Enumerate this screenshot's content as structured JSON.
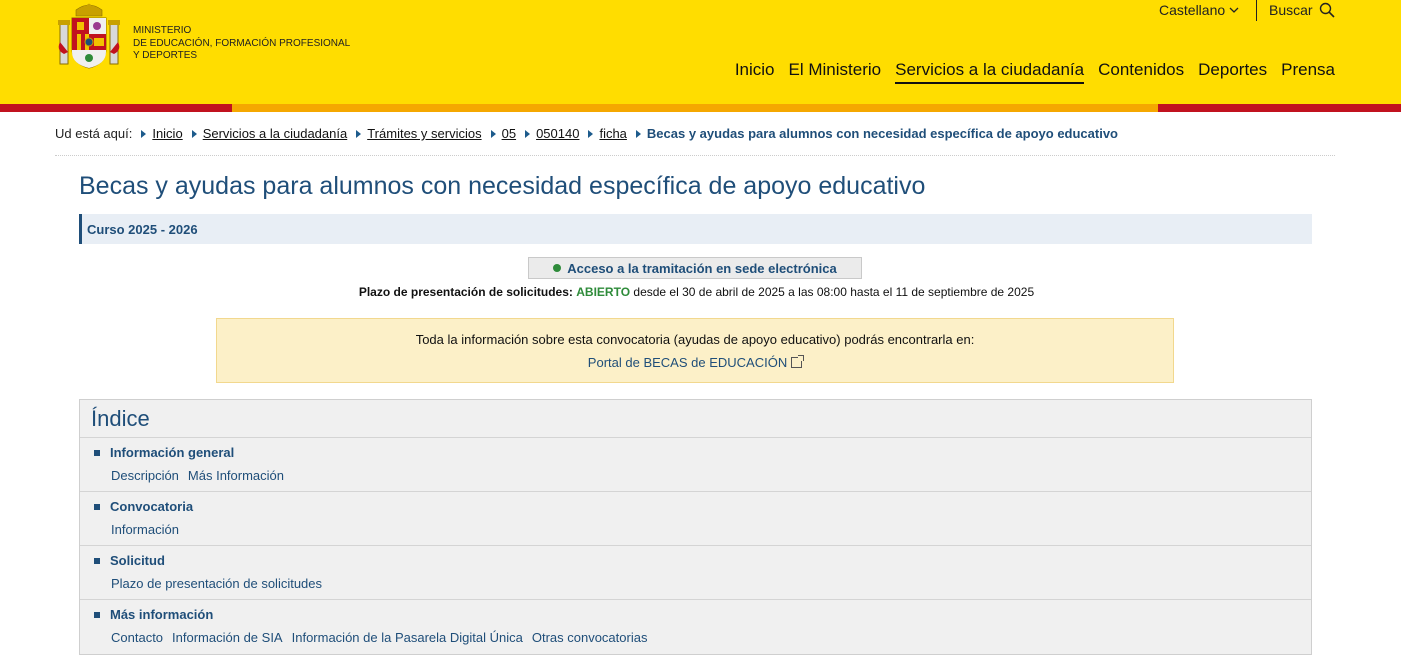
{
  "header": {
    "ministry_lines": [
      "MINISTERIO",
      "DE EDUCACIÓN, FORMACIÓN PROFESIONAL",
      "Y DEPORTES"
    ],
    "language": "Castellano",
    "search_label": "Buscar",
    "nav": [
      {
        "label": "Inicio",
        "active": false
      },
      {
        "label": "El Ministerio",
        "active": false
      },
      {
        "label": "Servicios a la ciudadanía",
        "active": true
      },
      {
        "label": "Contenidos",
        "active": false
      },
      {
        "label": "Deportes",
        "active": false
      },
      {
        "label": "Prensa",
        "active": false
      }
    ]
  },
  "breadcrumb": {
    "prefix": "Ud está aquí:",
    "items": [
      "Inicio",
      "Servicios a la ciudadanía",
      "Trámites y servicios",
      "05",
      "050140",
      "ficha"
    ],
    "current": "Becas y ayudas para alumnos con necesidad específica de apoyo educativo"
  },
  "page": {
    "title": "Becas y ayudas para alumnos con necesidad específica de apoyo educativo",
    "course": "Curso 2025 - 2026",
    "sede_button": "Acceso a la tramitación en sede electrónica",
    "plazo_label": "Plazo de presentación de solicitudes:",
    "plazo_status": "ABIERTO",
    "plazo_dates": "desde el 30 de abril de 2025 a las 08:00 hasta el 11 de septiembre de 2025",
    "info_text": "Toda la información sobre esta convocatoria (ayudas de apoyo educativo) podrás encontrarla en:",
    "info_link": "Portal de BECAS de EDUCACIÓN"
  },
  "index": {
    "title": "Índice",
    "sections": [
      {
        "heading": "Información general",
        "links": [
          "Descripción",
          "Más Información"
        ]
      },
      {
        "heading": "Convocatoria",
        "links": [
          "Información"
        ]
      },
      {
        "heading": "Solicitud",
        "links": [
          "Plazo de presentación de solicitudes"
        ]
      },
      {
        "heading": "Más información",
        "links": [
          "Contacto",
          "Información de SIA",
          "Información de la Pasarela Digital Única",
          "Otras convocatorias"
        ]
      }
    ]
  },
  "colors": {
    "header_yellow": "#ffdd00",
    "stripe_red": "#c1121f",
    "stripe_gold": "#f5a800",
    "primary_blue": "#1f4e79",
    "open_green": "#2e8b3a"
  }
}
